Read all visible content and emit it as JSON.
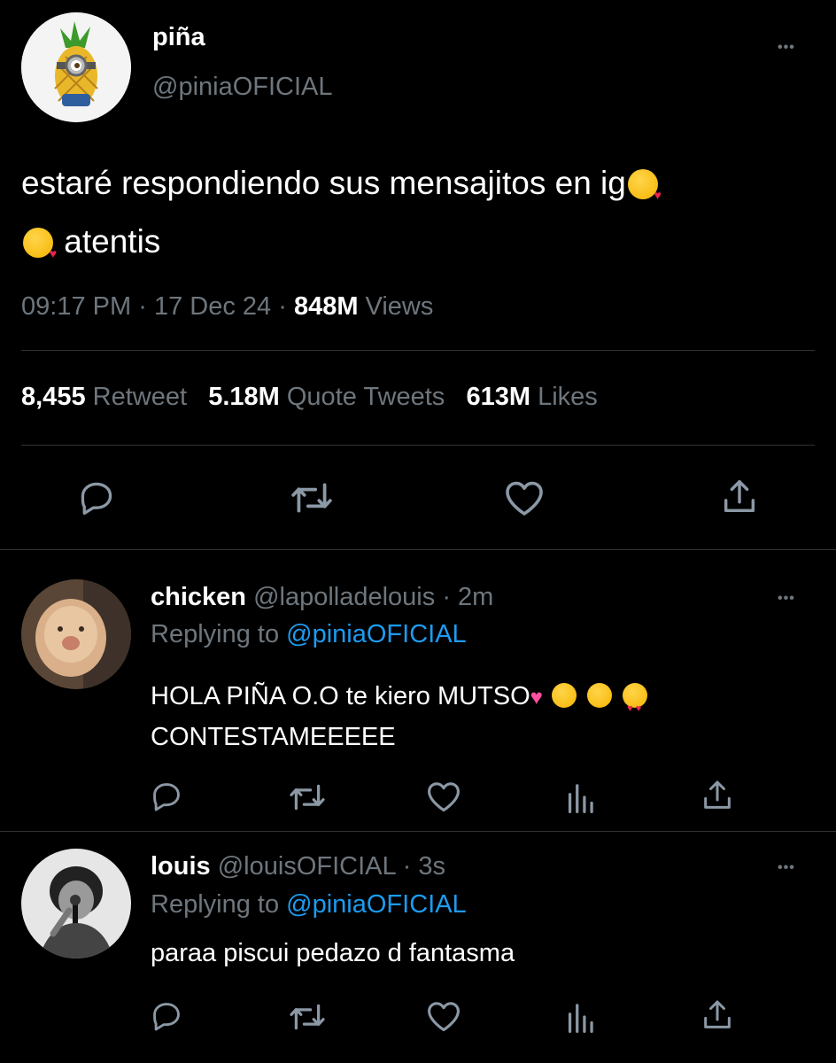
{
  "tweet": {
    "display_name": "piña",
    "handle": "@piniaOFICIAL",
    "text_line1": "estaré respondiendo sus mensajitos en ig",
    "text_line2": "atentis",
    "time": "09:17 PM",
    "date": "17 Dec 24",
    "views_count": "848M",
    "views_label": "Views",
    "stats": {
      "retweets_count": "8,455",
      "retweets_label": "Retweet",
      "quotes_count": "5.18M",
      "quotes_label": "Quote Tweets",
      "likes_count": "613M",
      "likes_label": "Likes"
    }
  },
  "replies": [
    {
      "display_name": "chicken",
      "handle": "@lapolladelouis",
      "time": "2m",
      "replying_prefix": "Replying to",
      "replying_handle": "@piniaOFICIAL",
      "text_line1": "HOLA PIÑA O.O te kiero MUTSO",
      "text_line2": "CONTESTAMEEEEE"
    },
    {
      "display_name": "louis",
      "handle": "@louisOFICIAL",
      "time": "3s",
      "replying_prefix": "Replying to",
      "replying_handle": "@piniaOFICIAL",
      "text_line1": "paraa piscui pedazo d fantasma"
    }
  ],
  "separator_dot": "·",
  "more_glyph": "•••",
  "colors": {
    "background": "#000000",
    "accent": "#1d9bf0",
    "muted": "#6e767d",
    "divider": "#2f3336"
  },
  "icons": [
    "reply-icon",
    "retweet-icon",
    "like-icon",
    "analytics-icon",
    "share-icon",
    "more-icon",
    "kiss-emoji",
    "drool-emoji",
    "heart-eyes-emoji",
    "two-hearts-emoji"
  ]
}
